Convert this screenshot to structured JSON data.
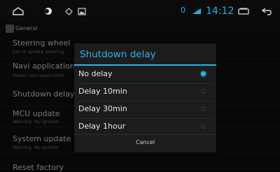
{
  "statusbar": {
    "icons": [
      "home-icon",
      "circle-icon",
      "diamond-icon",
      "image-icon",
      "battery-icon",
      "back-icon"
    ],
    "indicator": "0",
    "clock": "14:12"
  },
  "app": {
    "title": "General"
  },
  "settings": {
    "items": [
      {
        "title": "Steering wheel",
        "subtitle": "Set or update steering"
      },
      {
        "title": "Navi application",
        "subtitle": "Select navi application"
      },
      {
        "title": "Shutdown delay",
        "subtitle": ""
      },
      {
        "title": "MCU update",
        "subtitle": "Warning: No ignition"
      },
      {
        "title": "System update",
        "subtitle": "Warning: No ignition"
      },
      {
        "title": "Reset factory",
        "subtitle": ""
      }
    ]
  },
  "dialog": {
    "title": "Shutdown delay",
    "options": [
      {
        "label": "No delay",
        "selected": true
      },
      {
        "label": "Delay 10min",
        "selected": false
      },
      {
        "label": "Delay 30min",
        "selected": false
      },
      {
        "label": "Delay 1hour",
        "selected": false
      }
    ],
    "cancel_label": "Cancel",
    "accent": "#2fb2e3"
  }
}
